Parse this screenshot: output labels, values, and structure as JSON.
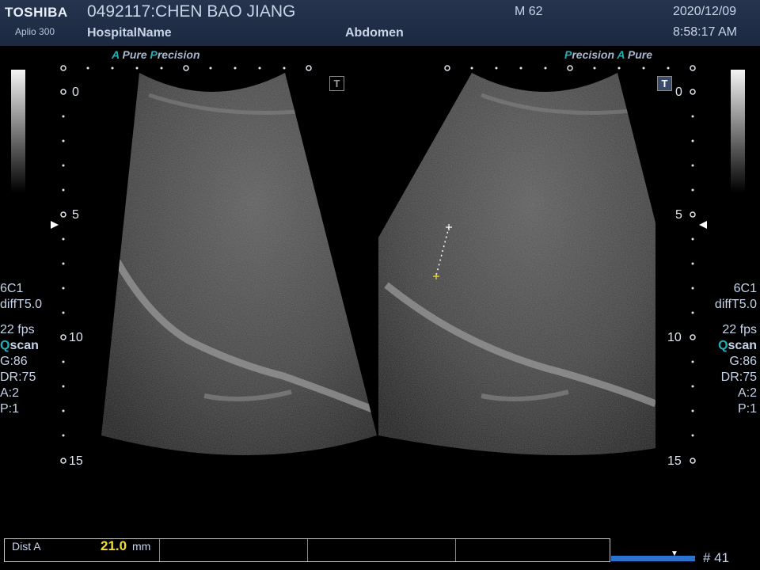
{
  "header": {
    "brand": "TOSHIBA",
    "model": "Aplio 300",
    "patient": "0492117:CHEN BAO JIANG",
    "hospital": "HospitalName",
    "exam": "Abdomen",
    "mi": "M 62",
    "date": "2020/12/09",
    "time": "8:58:17 AM"
  },
  "left_panel": {
    "tech_a": "A",
    "tech_pure": "Pure",
    "tech_p": "P",
    "tech_precision": "recision",
    "probe": "6C1",
    "filter": "diffT5.0",
    "fps": "22 fps",
    "qscan_q": "Q",
    "qscan_rest": "scan",
    "gain": "G:86",
    "dr": "DR:75",
    "a": "A:2",
    "p": "P:1"
  },
  "right_panel": {
    "tech_p": "P",
    "tech_precision": "recision",
    "tech_a": "A",
    "tech_pure": "Pure",
    "probe": "6C1",
    "filter": "diffT5.0",
    "fps": "22 fps",
    "qscan_q": "Q",
    "qscan_rest": "scan",
    "gain": "G:86",
    "dr": "DR:75",
    "a": "A:2",
    "p": "P:1"
  },
  "depth": {
    "d0": "0",
    "d5": "5",
    "d10": "10",
    "d15": "15"
  },
  "t_button": "T",
  "measurement": {
    "label": "Dist A",
    "value": "21.0",
    "unit": "mm"
  },
  "frame": "# 41",
  "colors": {
    "accent": "#20b0b8",
    "measurement_value": "#f2e030",
    "cine_bar": "#2a74d0",
    "header_bg": "#1f2d47"
  }
}
